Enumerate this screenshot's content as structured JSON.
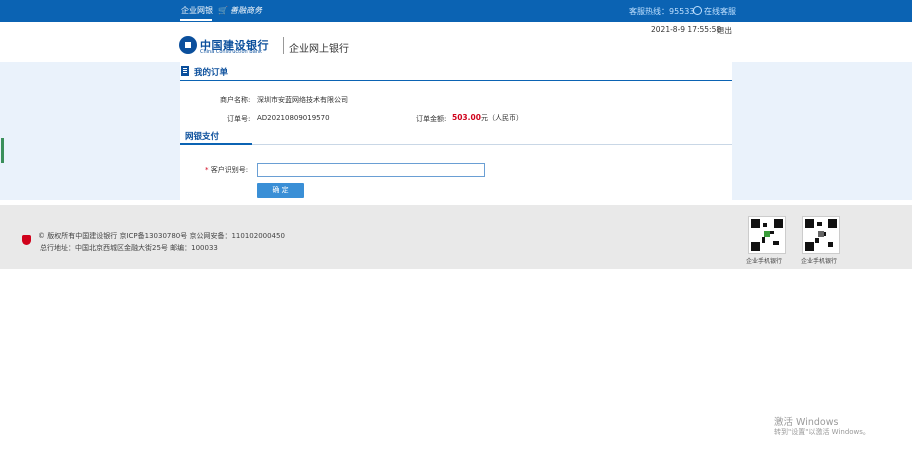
{
  "topbar": {
    "tab_label": "企业网银",
    "fin_label": "善融商务",
    "cart_icon": "cart-icon",
    "hotline": "客服热线：95533",
    "service_label": "在线客服",
    "person_icon": "person-icon"
  },
  "header": {
    "datetime": "2021-8-9 17:55:58",
    "logout": "退出",
    "logo_cn": "中国建设银行",
    "logo_en": "China Construction Bank",
    "subtitle": "企业网上银行"
  },
  "order": {
    "section_title": "我的订单",
    "merchant_label": "商户名称:",
    "merchant_value": "深圳市安蓝网络技术有限公司",
    "order_no_label": "订单号:",
    "order_no_value": "AD20210809019570",
    "amount_label": "订单金额:",
    "amount_value": "503.00",
    "amount_suffix": "元（人民币）"
  },
  "payment": {
    "section_title": "网银支付",
    "required_mark": "*",
    "customer_id_label": "客户识别号:",
    "customer_id_value": "",
    "confirm_label": "确 定"
  },
  "footer": {
    "copyright": "© 版权所有中国建设银行   京ICP备13030780号   京公网安备：110102000450",
    "address": "总行地址：中国北京西城区金融大街25号   邮编：100033",
    "qr_label_1": "企业手机银行",
    "qr_label_2": "企业手机银行"
  },
  "os_watermark": {
    "line1": "激活 Windows",
    "line2": "转到\"设置\"以激活 Windows。"
  },
  "colors": {
    "brand_blue": "#0b63b3",
    "amount_red": "#d0021b",
    "band_bg": "#eaf2fb"
  }
}
